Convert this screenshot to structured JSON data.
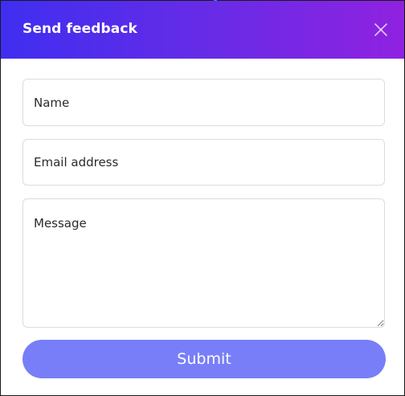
{
  "dialog": {
    "title": "Send feedback",
    "close_icon": "close-icon",
    "header_gradient": [
      "#3f2ef0",
      "#6a2be6",
      "#8f22e0"
    ]
  },
  "form": {
    "name_placeholder": "Name",
    "email_placeholder": "Email address",
    "message_placeholder": "Message",
    "submit_label": "Submit",
    "submit_color": "#787ef8"
  }
}
